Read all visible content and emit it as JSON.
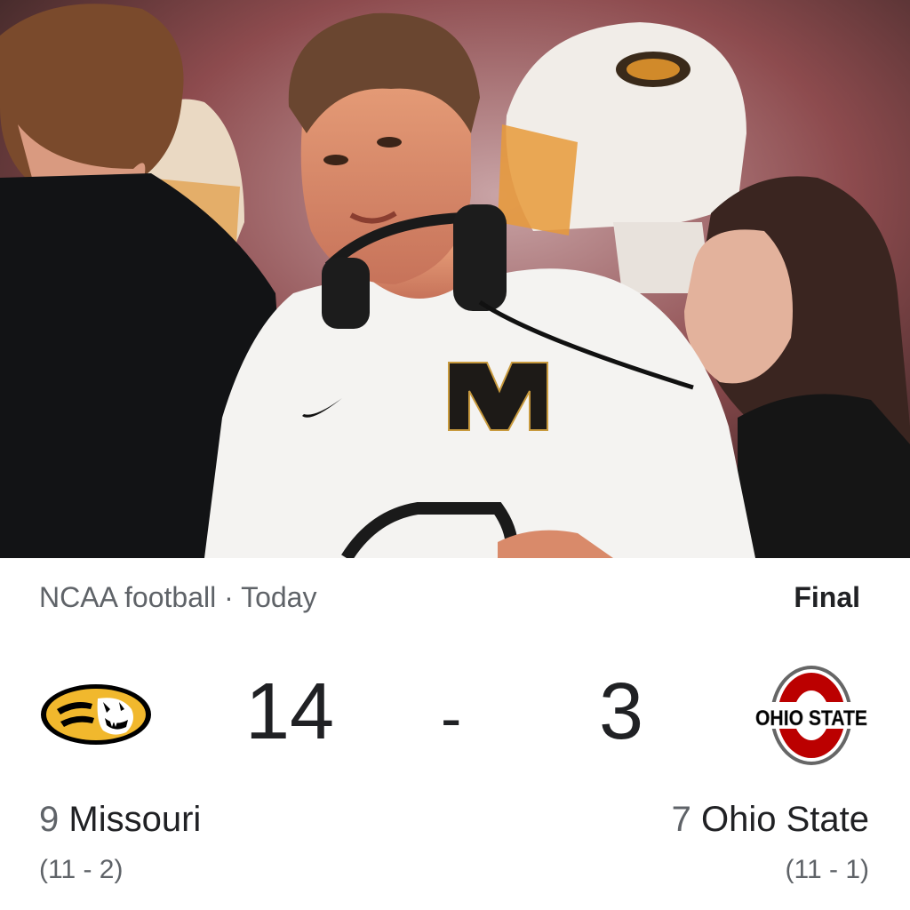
{
  "header": {
    "league": "NCAA football",
    "separator": "·",
    "date": "Today",
    "status": "Final"
  },
  "home": {
    "rank": "9",
    "name": "Missouri",
    "score": "14",
    "record": "(11 - 2)",
    "logo": "missouri-tiger-logo"
  },
  "away": {
    "rank": "7",
    "name": "Ohio State",
    "score": "3",
    "record": "(11 - 1)",
    "logo": "ohio-state-logo"
  },
  "score_separator": "-",
  "photo": {
    "shirt_letter": "M"
  },
  "colors": {
    "missouri_gold": "#F1B82D",
    "missouri_black": "#000000",
    "ohio_scarlet": "#BB0000",
    "ohio_gray": "#666666",
    "text_primary": "#202124",
    "text_secondary": "#5f6368"
  }
}
